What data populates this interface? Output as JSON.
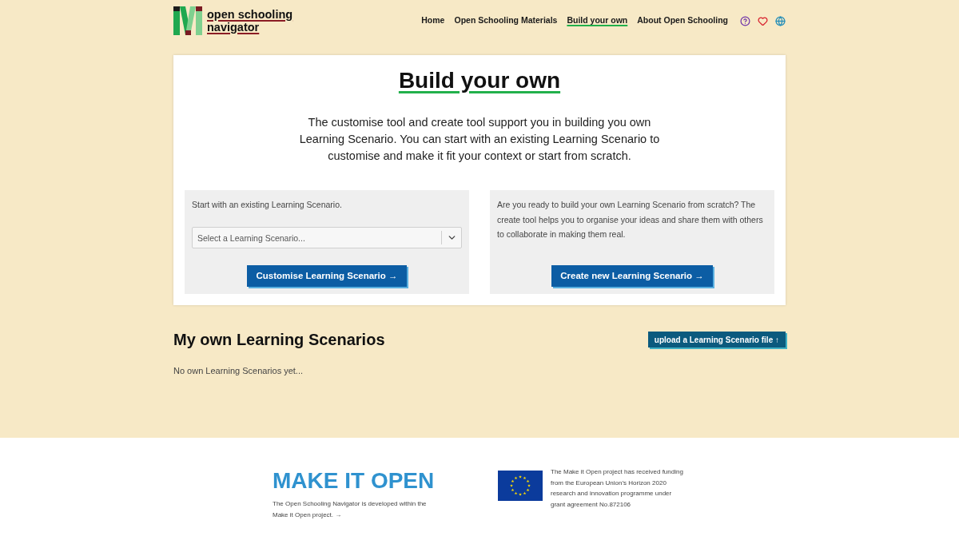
{
  "header": {
    "logo_lines": [
      "open schooling",
      "navigator"
    ],
    "nav": [
      {
        "label": "Home",
        "selected": false
      },
      {
        "label": "Open Schooling Materials",
        "selected": false
      },
      {
        "label": "Build your own",
        "selected": true
      },
      {
        "label": "About Open Schooling",
        "selected": false
      }
    ]
  },
  "intro": {
    "title": "Build your own",
    "text": "The customise tool and create tool support you in building you own Learning Scenario. You can start with an existing Learning Scenario to customise and make it fit your context or start from scratch."
  },
  "panels": [
    {
      "kind": "select",
      "text": "Start with an existing Learning Scenario.",
      "placeholder": "Select a Learning Scenario...",
      "button": "Customise Learning Scenario →"
    },
    {
      "kind": "text",
      "text": "Are you ready to build your own Learning Scenario from scratch? The create tool helps you to organise your ideas and share them with others to collaborate in making them real.",
      "button": "Create new Learning Scenario →"
    }
  ],
  "my_scenarios": {
    "title": "My own Learning Scenarios",
    "upload_button": "upload a Learning Scenario file ↑",
    "empty_text": "No own Learning Scenarios yet..."
  },
  "footer": {
    "logo": "MAKE IT OPEN",
    "note": "The Open Schooling Navigator is developed within the Make it Open project. →",
    "funding": "The Make it Open project has received funding from the European Union’s Horizon 2020 research and innovation programme under grant agreement No.872106"
  }
}
